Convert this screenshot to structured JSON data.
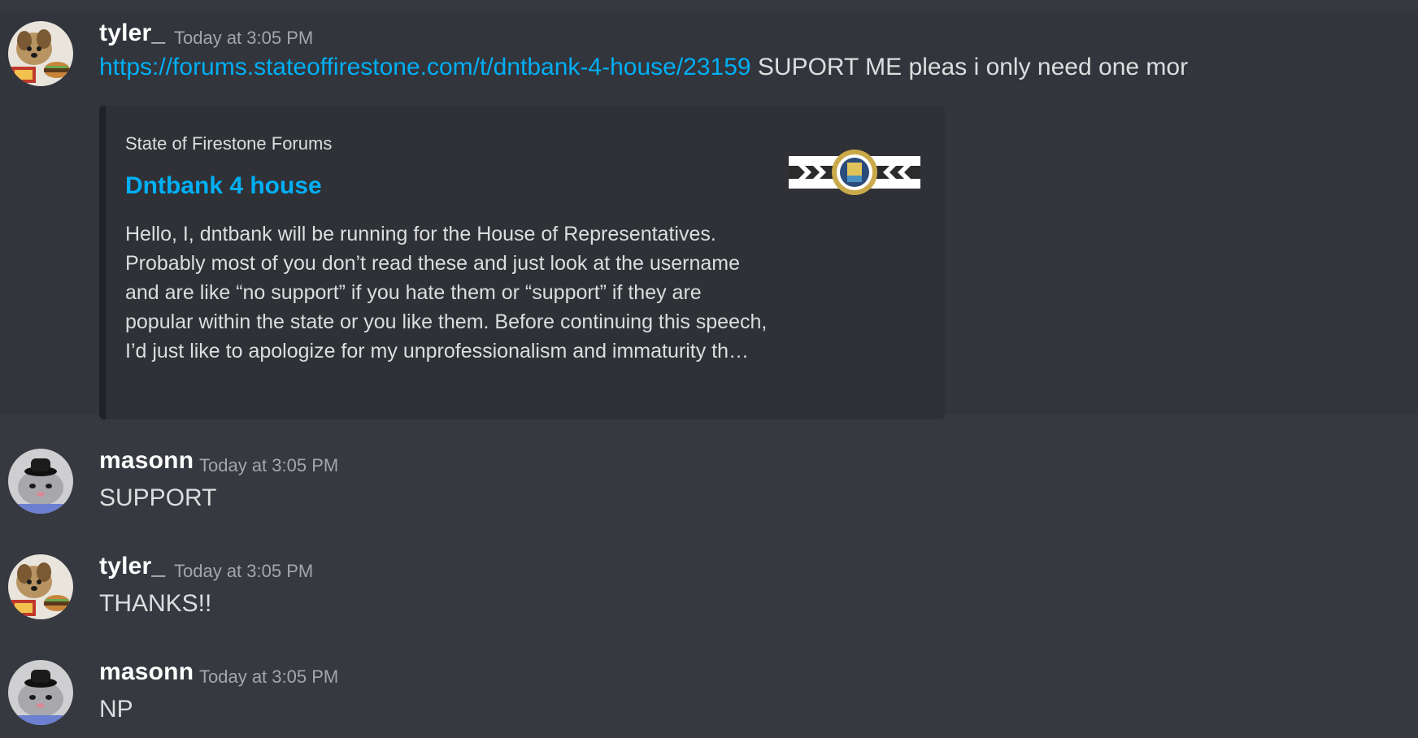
{
  "messages": [
    {
      "username": "tyler_",
      "timestamp": "Today at 3:05 PM",
      "link": "https://forums.stateoffirestone.com/t/dntbank-4-house/23159",
      "text": " SUPORT ME pleas i only need one mor",
      "avatar_icon": "dog-avatar",
      "embed": {
        "provider": "State of Firestone Forums",
        "title": "Dntbank 4 house",
        "description": "Hello, I, dntbank will be running for the House of Representatives. Probably most of you don’t read these and just look at the username and are like “no support” if you hate them or “support” if they are popular within the state or you like them. Before continuing this speech, I’d just like to apologize for my unprofessionalism and immaturity th…",
        "thumbnail_icon": "state-seal-banner"
      }
    },
    {
      "username": "masonn",
      "timestamp": "Today at 3:05 PM",
      "text": "SUPPORT",
      "avatar_icon": "rat-with-hat-avatar"
    },
    {
      "username": "tyler_",
      "timestamp": "Today at 3:05 PM",
      "text": "THANKS!!",
      "avatar_icon": "dog-avatar"
    },
    {
      "username": "masonn",
      "timestamp": "Today at 3:05 PM",
      "text": "NP",
      "avatar_icon": "rat-with-hat-avatar"
    }
  ],
  "colors": {
    "background": "#36393f",
    "link": "#00aff4",
    "embed_background": "#2f3136",
    "text": "#dcddde",
    "muted": "#a3a6aa"
  }
}
